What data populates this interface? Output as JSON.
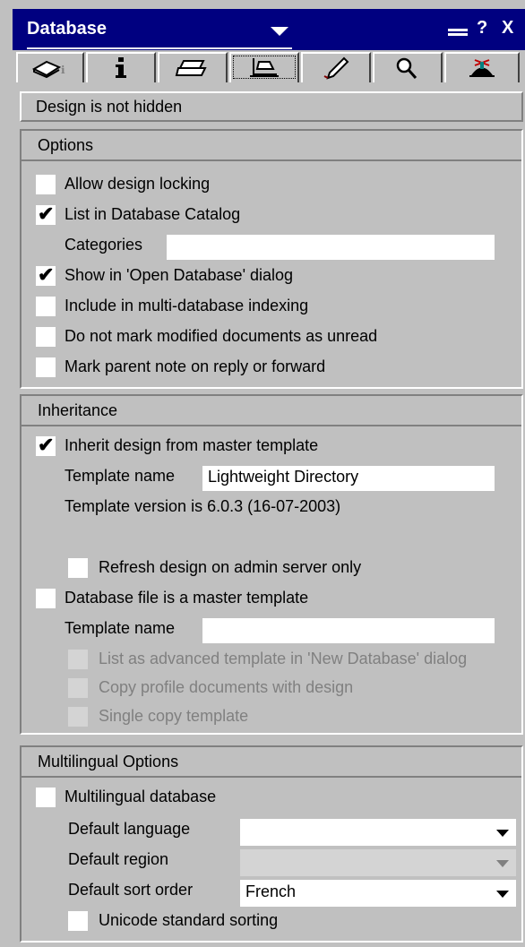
{
  "window": {
    "title": "Database",
    "controls": {
      "minimize": "min-icon",
      "help": "?",
      "close": "X"
    }
  },
  "tabs": [
    {
      "name": "basics-tab",
      "icon": "book-icon"
    },
    {
      "name": "info-tab",
      "icon": "info-icon"
    },
    {
      "name": "print-tab",
      "icon": "printer-icon"
    },
    {
      "name": "design-tab",
      "icon": "design-icon",
      "active": true
    },
    {
      "name": "launch-tab",
      "icon": "rocket-icon"
    },
    {
      "name": "search-tab",
      "icon": "magnifier-icon"
    },
    {
      "name": "advanced-tab",
      "icon": "propeller-hat-icon"
    }
  ],
  "design_status": "Design is not hidden",
  "options": {
    "heading": "Options",
    "allow_design_locking": {
      "label": "Allow design locking",
      "checked": false
    },
    "list_in_catalog": {
      "label": "List in Database Catalog",
      "checked": true
    },
    "categories": {
      "label": "Categories",
      "value": ""
    },
    "show_open_dialog": {
      "label": "Show in 'Open Database' dialog",
      "checked": true
    },
    "multi_db_indexing": {
      "label": "Include in multi-database indexing",
      "checked": false
    },
    "no_mark_unread": {
      "label": "Do not mark modified documents as unread",
      "checked": false
    },
    "mark_parent_note": {
      "label": "Mark parent note on reply or forward",
      "checked": false
    }
  },
  "inheritance": {
    "heading": "Inheritance",
    "inherit_design": {
      "label": "Inherit design from master template",
      "checked": true
    },
    "template_name": {
      "label": "Template name",
      "value": "Lightweight Directory"
    },
    "template_version": "Template version is 6.0.3 (16-07-2003)",
    "refresh_admin": {
      "label": "Refresh design on admin server only",
      "checked": false
    },
    "master_template": {
      "label": "Database file is a master template",
      "checked": false
    },
    "master_template_name": {
      "label": "Template name",
      "value": ""
    },
    "list_advanced": {
      "label": "List as advanced template in 'New Database' dialog",
      "checked": false
    },
    "copy_profile": {
      "label": "Copy profile documents with design",
      "checked": false
    },
    "single_copy": {
      "label": "Single copy template",
      "checked": false
    }
  },
  "multilingual": {
    "heading": "Multilingual Options",
    "multilingual_db": {
      "label": "Multilingual database",
      "checked": false
    },
    "default_language": {
      "label": "Default language",
      "value": ""
    },
    "default_region": {
      "label": "Default region",
      "value": ""
    },
    "default_sort": {
      "label": "Default sort order",
      "value": "French"
    },
    "unicode_sorting": {
      "label": "Unicode standard sorting",
      "checked": false
    }
  },
  "check_glyph": "✔"
}
